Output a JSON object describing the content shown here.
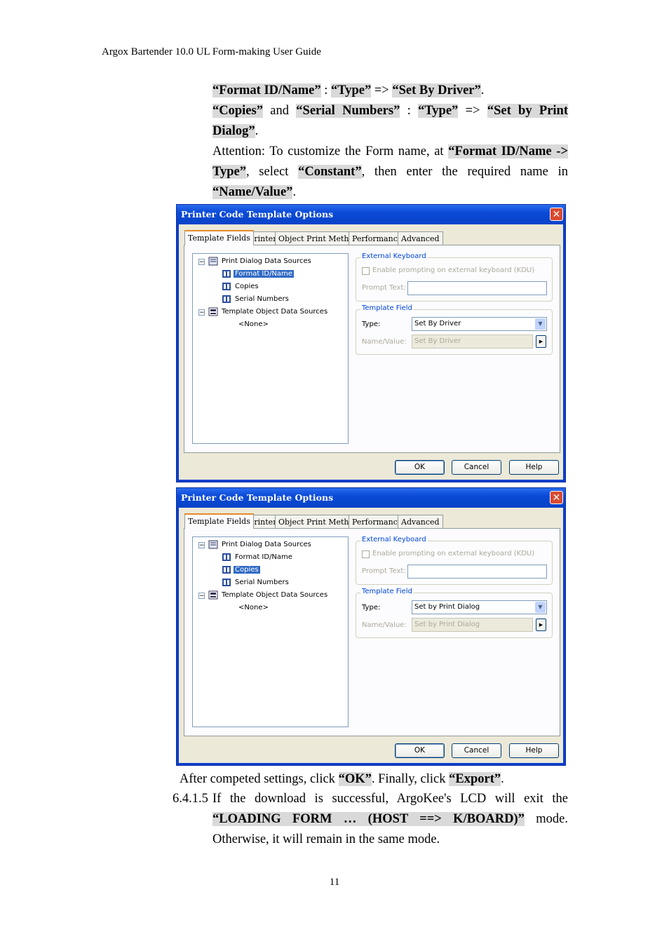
{
  "header": "Argox Bartender 10.0 UL Form-making User Guide",
  "intro": {
    "line1": {
      "a": "“Format ID/Name”",
      "b": " : ",
      "c": "“Type”",
      "d": " => ",
      "e": "“Set By Driver”",
      "f": "."
    },
    "line2": {
      "a": "“Copies”",
      "b": " and ",
      "c": "“Serial Numbers”",
      "d": " : ",
      "e": "“Type”",
      "f": " => ",
      "g": "“Set by Print Dialog”",
      "h": "."
    },
    "attention": {
      "a": "Attention: To customize the Form name, at ",
      "b": "“Format ID/Name -> Type”",
      "c": ", select ",
      "d": "“Constant”",
      "e": ", then enter the required name in ",
      "f": "“Name/Value”",
      "g": "."
    }
  },
  "dialogs": [
    {
      "title": "Printer Code Template Options",
      "tabs": [
        "Template Fields",
        "Printer",
        "Object Print Method",
        "Performance",
        "Advanced"
      ],
      "tree": {
        "root1": "Print Dialog Data Sources",
        "children": [
          "Format ID/Name",
          "Copies",
          "Serial Numbers"
        ],
        "selected": "Format ID/Name",
        "root2": "Template Object Data Sources",
        "none": "<None>"
      },
      "external_keyboard": {
        "legend": "External Keyboard",
        "checkbox": "Enable prompting on external keyboard (KDU)",
        "prompt_label": "Prompt Text:",
        "prompt_value": ""
      },
      "template_field": {
        "legend": "Template Field",
        "type_label": "Type:",
        "type_value": "Set By Driver",
        "name_label": "Name/Value:",
        "name_value": "Set By Driver"
      },
      "buttons": {
        "ok": "OK",
        "cancel": "Cancel",
        "help": "Help"
      }
    },
    {
      "title": "Printer Code Template Options",
      "tabs": [
        "Template Fields",
        "Printer",
        "Object Print Method",
        "Performance",
        "Advanced"
      ],
      "tree": {
        "root1": "Print Dialog Data Sources",
        "children": [
          "Format ID/Name",
          "Copies",
          "Serial Numbers"
        ],
        "selected": "Copies",
        "root2": "Template Object Data Sources",
        "none": "<None>"
      },
      "external_keyboard": {
        "legend": "External Keyboard",
        "checkbox": "Enable prompting on external keyboard (KDU)",
        "prompt_label": "Prompt Text:",
        "prompt_value": ""
      },
      "template_field": {
        "legend": "Template Field",
        "type_label": "Type:",
        "type_value": "Set by Print Dialog",
        "name_label": "Name/Value:",
        "name_value": "Set by Print Dialog"
      },
      "buttons": {
        "ok": "OK",
        "cancel": "Cancel",
        "help": "Help"
      }
    }
  ],
  "after": {
    "a": "After competed settings, click ",
    "b": "“OK”",
    "c": ". Finally, click ",
    "d": "“Export”",
    "e": "."
  },
  "step": {
    "num": "6.4.1.5",
    "a": "If the download is successful, ArgoKee's LCD will exit the ",
    "b": "“LOADING FORM … (HOST ==> K/BOARD)”",
    "c": " mode. Otherwise, it will remain in the same mode."
  },
  "page_number": "11"
}
